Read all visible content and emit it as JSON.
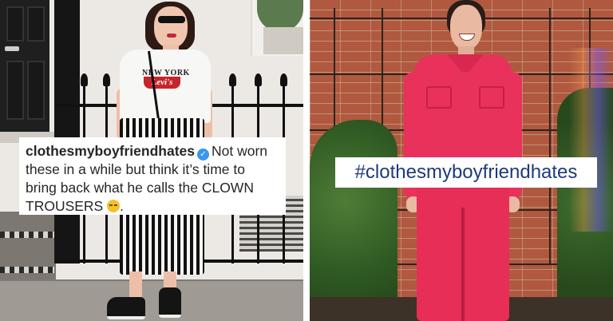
{
  "left_post": {
    "username": "clothesmyboyfriendhates",
    "caption": "Not worn these in a while but think it’s time to bring back what he calls the CLOWN TROUSERS",
    "caption_end": ".",
    "emoji": "unamused-face-icon",
    "verified": "verified-badge-icon",
    "shirt_text_top": "NEW YORK",
    "shirt_logo": "Levi's"
  },
  "right_post": {
    "hashtag": "#clothesmyboyfriendhates"
  },
  "colors": {
    "verified_blue": "#3897f0",
    "hashtag_blue": "#1e3a7a",
    "jumpsuit_pink": "#e8325b",
    "brick": "#b0593f"
  }
}
